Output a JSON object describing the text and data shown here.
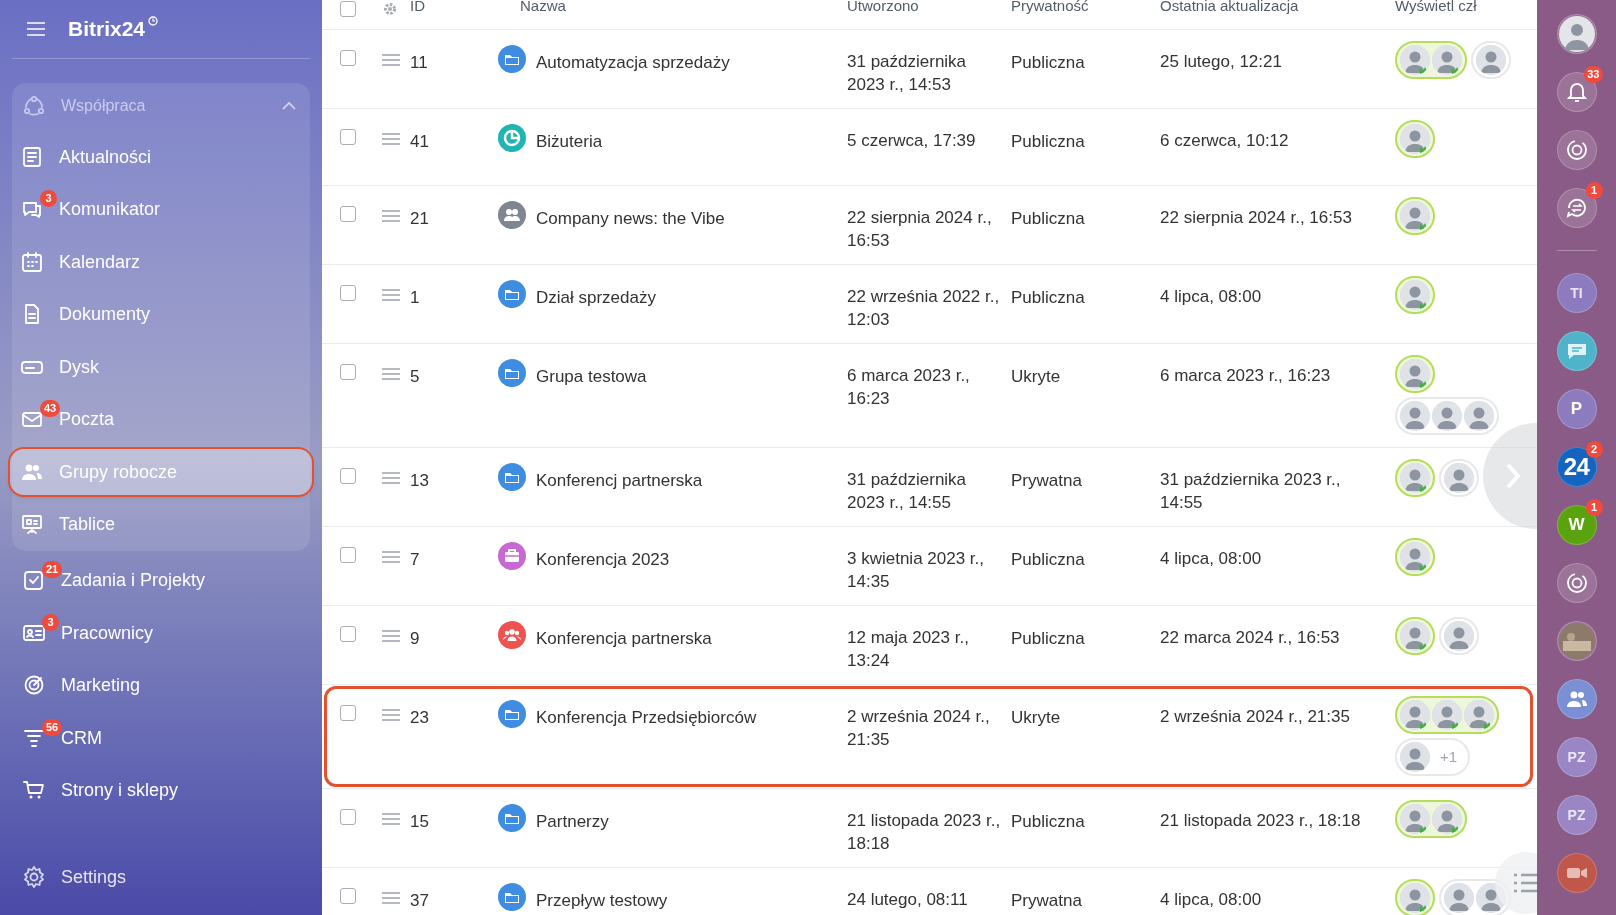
{
  "brand": {
    "name": "Bitrix24"
  },
  "sidebar": {
    "group": {
      "label": "Współpraca",
      "expanded": true,
      "items": [
        {
          "label": "Aktualności",
          "kind": "news",
          "selected": false
        },
        {
          "label": "Komunikator",
          "kind": "chat",
          "badge": "3",
          "selected": false
        },
        {
          "label": "Kalendarz",
          "kind": "calendar",
          "selected": false
        },
        {
          "label": "Dokumenty",
          "kind": "doc",
          "selected": false
        },
        {
          "label": "Dysk",
          "kind": "disk",
          "selected": false
        },
        {
          "label": "Poczta",
          "kind": "mail",
          "badge": "43",
          "selected": false
        },
        {
          "label": "Grupy robocze",
          "kind": "people",
          "selected": true
        },
        {
          "label": "Tablice",
          "kind": "board",
          "selected": false
        }
      ]
    },
    "items": [
      {
        "label": "Zadania i Projekty",
        "kind": "task",
        "badge": "21",
        "selected": false
      },
      {
        "label": "Pracownicy",
        "kind": "card",
        "badge": "3",
        "selected": false
      },
      {
        "label": "Marketing",
        "kind": "target",
        "selected": false
      },
      {
        "label": "CRM",
        "kind": "funnel",
        "badge": "56",
        "selected": false
      },
      {
        "label": "Strony i sklepy",
        "kind": "cart",
        "selected": false
      }
    ],
    "settings": {
      "label": "Settings"
    }
  },
  "table": {
    "header_checked": false,
    "columns": [
      "ID",
      "Nazwa",
      "Utworzono",
      "Prywatność",
      "Ostatnia aktualizacja",
      "Wyświetl czł"
    ],
    "rows": [
      {
        "checked": false,
        "id": "11",
        "kind": "folder",
        "name": "Automatyzacja sprzedaży",
        "created": "31 października 2023 r., 14:53",
        "privacy": "Publiczna",
        "updated": "25 lutego, 12:21",
        "outlined": false,
        "pills": [
          {
            "highlighted": true,
            "avatars": [
              {
                "badge": true
              },
              {
                "badge": true
              }
            ]
          },
          {
            "highlighted": false,
            "avatars": [
              {
                "badge": false
              }
            ]
          }
        ]
      },
      {
        "checked": false,
        "id": "41",
        "kind": "pie",
        "name": "Biżuteria",
        "created": "5 czerwca, 17:39",
        "privacy": "Publiczna",
        "updated": "6 czerwca, 10:12",
        "outlined": false,
        "pills": [
          {
            "highlighted": true,
            "avatars": [
              {
                "badge": true
              }
            ]
          }
        ]
      },
      {
        "checked": false,
        "id": "21",
        "kind": "people",
        "name": "Company news: the Vibe",
        "created": "22 sierpnia 2024 r., 16:53",
        "privacy": "Publiczna",
        "updated": "22 sierpnia 2024 r., 16:53",
        "outlined": false,
        "pills": [
          {
            "highlighted": true,
            "avatars": [
              {
                "badge": true
              }
            ]
          }
        ]
      },
      {
        "checked": false,
        "id": "1",
        "kind": "folder",
        "name": "Dział sprzedaży",
        "created": "22 września 2022 r., 12:03",
        "privacy": "Publiczna",
        "updated": "4 lipca, 08:00",
        "outlined": false,
        "pills": [
          {
            "highlighted": true,
            "avatars": [
              {
                "badge": true
              }
            ]
          }
        ]
      },
      {
        "checked": false,
        "id": "5",
        "kind": "folder",
        "name": "Grupa testowa",
        "created": "6 marca 2023 r., 16:23",
        "privacy": "Ukryte",
        "updated": "6 marca 2023 r., 16:23",
        "outlined": false,
        "pills": [
          {
            "highlighted": true,
            "avatars": [
              {
                "badge": true
              }
            ]
          },
          {
            "highlighted": false,
            "avatars": [
              {
                "badge": false
              },
              {
                "badge": false
              },
              {
                "badge": false
              }
            ]
          }
        ]
      },
      {
        "checked": false,
        "id": "13",
        "kind": "folder",
        "name": "Konferencj partnerska",
        "created": "31 października 2023 r., 14:55",
        "privacy": "Prywatna",
        "updated": "31 października 2023 r., 14:55",
        "outlined": false,
        "pills": [
          {
            "highlighted": true,
            "avatars": [
              {
                "badge": true
              }
            ]
          },
          {
            "highlighted": false,
            "avatars": [
              {
                "badge": false
              }
            ]
          }
        ]
      },
      {
        "checked": false,
        "id": "7",
        "kind": "briefcase",
        "name": "Konferencja 2023",
        "created": "3 kwietnia 2023 r., 14:35",
        "privacy": "Publiczna",
        "updated": "4 lipca, 08:00",
        "outlined": false,
        "pills": [
          {
            "highlighted": true,
            "avatars": [
              {
                "badge": true
              }
            ]
          }
        ]
      },
      {
        "checked": false,
        "id": "9",
        "kind": "group",
        "name": "Konferencja partnerska",
        "created": "12 maja 2023 r., 13:24",
        "privacy": "Publiczna",
        "updated": "22 marca 2024 r., 16:53",
        "outlined": false,
        "pills": [
          {
            "highlighted": true,
            "avatars": [
              {
                "badge": true
              }
            ]
          },
          {
            "highlighted": false,
            "avatars": [
              {
                "badge": false
              }
            ]
          }
        ]
      },
      {
        "checked": false,
        "id": "23",
        "kind": "folder",
        "name": "Konferencja Przedsiębiorców",
        "created": "2 września 2024 r., 21:35",
        "privacy": "Ukryte",
        "updated": "2 września 2024 r., 21:35",
        "outlined": true,
        "pills": [
          {
            "highlighted": true,
            "avatars": [
              {
                "badge": true
              },
              {
                "badge": true
              },
              {
                "badge": true
              }
            ]
          },
          {
            "highlighted": false,
            "avatars": [
              {
                "badge": false
              }
            ],
            "extra": "+1"
          }
        ]
      },
      {
        "checked": false,
        "id": "15",
        "kind": "folder",
        "name": "Partnerzy",
        "created": "21 listopada 2023 r., 18:18",
        "privacy": "Publiczna",
        "updated": "21 listopada 2023 r., 18:18",
        "outlined": false,
        "pills": [
          {
            "highlighted": true,
            "avatars": [
              {
                "badge": true
              },
              {
                "badge": true
              }
            ]
          }
        ]
      },
      {
        "checked": false,
        "id": "37",
        "kind": "folder",
        "name": "Przepływ testowy",
        "created": "24 lutego, 08:11",
        "privacy": "Prywatna",
        "updated": "4 lipca, 08:00",
        "outlined": false,
        "pills": [
          {
            "highlighted": true,
            "avatars": [
              {
                "badge": true
              }
            ]
          },
          {
            "highlighted": false,
            "avatars": [
              {
                "badge": false
              },
              {
                "badge": false
              }
            ]
          }
        ]
      }
    ]
  },
  "right_bar": [
    {
      "kind": "avatar"
    },
    {
      "kind": "bell",
      "badge": "33"
    },
    {
      "kind": "copilot"
    },
    {
      "kind": "exchange",
      "badge": "1"
    },
    {
      "kind": "divider"
    },
    {
      "kind": "letters",
      "text": "TI",
      "color": "#8c7bbf"
    },
    {
      "kind": "chat",
      "color": "#4fb3c9"
    },
    {
      "kind": "letters",
      "text": "P",
      "color": "#8c7bbf"
    },
    {
      "kind": "letters",
      "text": "24",
      "color": "#1565c0",
      "badge": "2"
    },
    {
      "kind": "letters",
      "text": "W",
      "color": "#5aa30f",
      "badge": "1"
    },
    {
      "kind": "copilot"
    },
    {
      "kind": "photo"
    },
    {
      "kind": "people",
      "color": "#7b8fd4"
    },
    {
      "kind": "letters",
      "text": "PZ",
      "color": "#9a86c4"
    },
    {
      "kind": "letters",
      "text": "PZ",
      "color": "#9a86c4"
    },
    {
      "kind": "video",
      "color": "#c0574a"
    }
  ]
}
